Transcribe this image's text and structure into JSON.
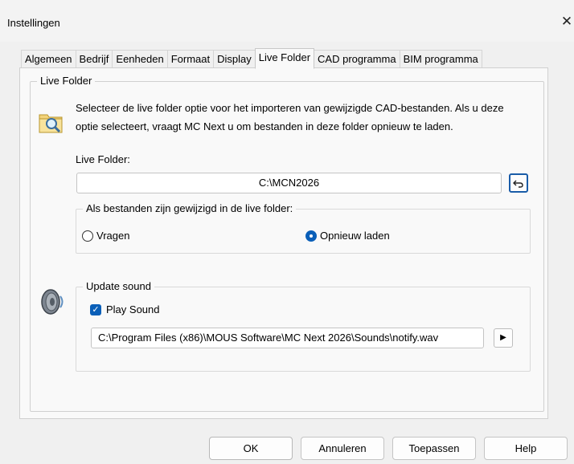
{
  "window": {
    "title": "Instellingen",
    "close_symbol": "✕"
  },
  "tabs": [
    {
      "label": "Algemeen",
      "active": false
    },
    {
      "label": "Bedrijf",
      "active": false
    },
    {
      "label": "Eenheden",
      "active": false
    },
    {
      "label": "Formaat",
      "active": false
    },
    {
      "label": "Display",
      "active": false
    },
    {
      "label": "Live Folder",
      "active": true
    },
    {
      "label": "CAD programma",
      "active": false
    },
    {
      "label": "BIM programma",
      "active": false
    }
  ],
  "live_folder": {
    "group_label": "Live Folder",
    "description": "Selecteer de live folder optie voor het importeren van gewijzigde CAD-bestanden. Als u deze optie selecteert, vraagt MC Next u om bestanden in deze folder opnieuw te laden.",
    "folder_label": "Live Folder:",
    "folder_value": "C:\\MCN2026",
    "browse_icon": "undo-folder-icon",
    "changed_group_label": "Als bestanden zijn gewijzigd in de live folder:",
    "option_ask": "Vragen",
    "option_reload": "Opnieuw laden",
    "selected_option": "Opnieuw laden"
  },
  "sound": {
    "group_label": "Update sound",
    "play_sound_label": "Play Sound",
    "play_sound_checked": true,
    "file_path": "C:\\Program Files (x86)\\MOUS Software\\MC Next 2026\\Sounds\\notify.wav",
    "play_icon": "play-icon"
  },
  "buttons": {
    "ok": "OK",
    "cancel": "Annuleren",
    "apply": "Toepassen",
    "help": "Help"
  },
  "colors": {
    "accent": "#0a5fb8",
    "background": "#f0f0f0",
    "panel": "#f9f9f9"
  }
}
